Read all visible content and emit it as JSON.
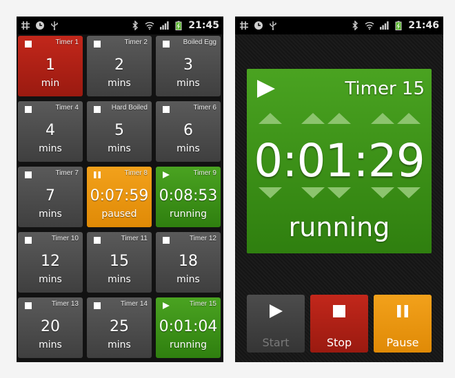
{
  "left_screen": {
    "statusbar": {
      "time": "21:45"
    },
    "tiles": [
      {
        "name": "Timer 1",
        "value": "1",
        "unit": "min",
        "color": "red",
        "status": "stopped"
      },
      {
        "name": "Timer 2",
        "value": "2",
        "unit": "mins",
        "color": "gray",
        "status": "stopped"
      },
      {
        "name": "Boiled Egg",
        "value": "3",
        "unit": "mins",
        "color": "gray",
        "status": "stopped"
      },
      {
        "name": "Timer 4",
        "value": "4",
        "unit": "mins",
        "color": "gray",
        "status": "stopped"
      },
      {
        "name": "Hard Boiled",
        "value": "5",
        "unit": "mins",
        "color": "gray",
        "status": "stopped"
      },
      {
        "name": "Timer 6",
        "value": "6",
        "unit": "mins",
        "color": "gray",
        "status": "stopped"
      },
      {
        "name": "Timer 7",
        "value": "7",
        "unit": "mins",
        "color": "gray",
        "status": "stopped"
      },
      {
        "name": "Timer 8",
        "value": "0:07:59",
        "unit": "paused",
        "color": "orange",
        "status": "paused"
      },
      {
        "name": "Timer 9",
        "value": "0:08:53",
        "unit": "running",
        "color": "green",
        "status": "running"
      },
      {
        "name": "Timer 10",
        "value": "12",
        "unit": "mins",
        "color": "gray",
        "status": "stopped"
      },
      {
        "name": "Timer 11",
        "value": "15",
        "unit": "mins",
        "color": "gray",
        "status": "stopped"
      },
      {
        "name": "Timer 12",
        "value": "18",
        "unit": "mins",
        "color": "gray",
        "status": "stopped"
      },
      {
        "name": "Timer 13",
        "value": "20",
        "unit": "mins",
        "color": "gray",
        "status": "stopped"
      },
      {
        "name": "Timer 14",
        "value": "25",
        "unit": "mins",
        "color": "gray",
        "status": "stopped"
      },
      {
        "name": "Timer 15",
        "value": "0:01:04",
        "unit": "running",
        "color": "green",
        "status": "running"
      }
    ]
  },
  "right_screen": {
    "statusbar": {
      "time": "21:46"
    },
    "detail": {
      "title": "Timer 15",
      "time": "0:01:29",
      "state": "running",
      "color": "green",
      "status_icon": "play-icon"
    },
    "controls": [
      {
        "id": "start",
        "label": "Start",
        "icon": "play-icon",
        "enabled": false
      },
      {
        "id": "stop",
        "label": "Stop",
        "icon": "stop-icon",
        "enabled": true
      },
      {
        "id": "pause",
        "label": "Pause",
        "icon": "pause-icon",
        "enabled": true
      }
    ]
  },
  "colors": {
    "red": "#b3221a",
    "orange": "#ee9a12",
    "green": "#3f951a",
    "gray": "#4c4c4c"
  },
  "statusbar_icons": [
    "hash-icon",
    "clock-icon",
    "usb-icon",
    "bluetooth-icon",
    "wifi-icon",
    "signal-icon",
    "battery-icon"
  ]
}
